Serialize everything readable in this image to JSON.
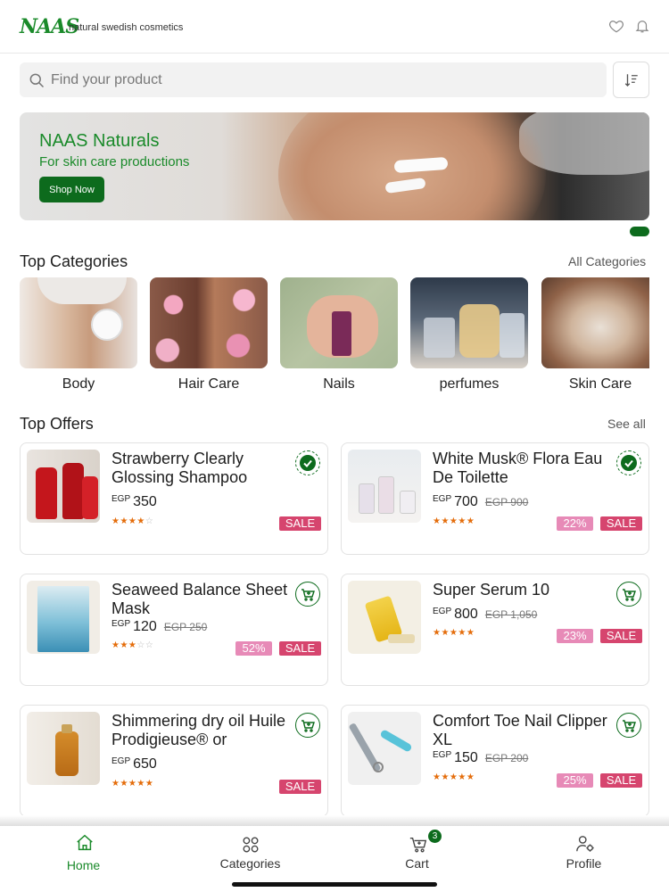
{
  "header": {
    "logo": "NAAS",
    "tagline": "natural swedish cosmetics",
    "icons": [
      "heart-icon",
      "bell-icon"
    ]
  },
  "search": {
    "placeholder": "Find your product",
    "value": ""
  },
  "banner": {
    "title": "NAAS Naturals",
    "subtitle": "For skin care productions",
    "button_label": "Shop Now",
    "active_slide": 1
  },
  "categories_section": {
    "title": "Top Categories",
    "link": "All Categories",
    "items": [
      {
        "label": "Body"
      },
      {
        "label": "Hair Care"
      },
      {
        "label": "Nails"
      },
      {
        "label": "perfumes"
      },
      {
        "label": "Skin Care"
      }
    ]
  },
  "offers_section": {
    "title": "Top Offers",
    "link": "See all",
    "items": [
      {
        "title": "Strawberry Clearly Glossing Shampoo",
        "currency": "EGP",
        "price": "350",
        "old_price": "",
        "rating": 4,
        "discount": "",
        "sale": "SALE",
        "action": "in-cart"
      },
      {
        "title": "White Musk® Flora Eau De Toilette",
        "currency": "EGP",
        "price": "700",
        "old_price": "EGP 900",
        "rating": 5,
        "discount": "22%",
        "sale": "SALE",
        "action": "in-cart"
      },
      {
        "title": "Seaweed Balance Sheet Mask",
        "currency": "EGP",
        "price": "120",
        "old_price": "EGP 250",
        "rating": 3,
        "discount": "52%",
        "sale": "SALE",
        "action": "add-to-cart"
      },
      {
        "title": "Super Serum 10",
        "currency": "EGP",
        "price": "800",
        "old_price": "EGP 1,050",
        "rating": 5,
        "discount": "23%",
        "sale": "SALE",
        "action": "add-to-cart"
      },
      {
        "title": "Shimmering dry oil Huile Prodigieuse® or",
        "currency": "EGP",
        "price": "650",
        "old_price": "",
        "rating": 5,
        "discount": "",
        "sale": "SALE",
        "action": "add-to-cart"
      },
      {
        "title": "Comfort Toe Nail Clipper XL",
        "currency": "EGP",
        "price": "150",
        "old_price": "EGP 200",
        "rating": 5,
        "discount": "25%",
        "sale": "SALE",
        "action": "add-to-cart"
      }
    ]
  },
  "bottom_nav": {
    "items": [
      {
        "label": "Home",
        "icon": "home-icon",
        "active": true
      },
      {
        "label": "Categories",
        "icon": "grid-icon",
        "active": false
      },
      {
        "label": "Cart",
        "icon": "cart-icon",
        "active": false,
        "badge": "3"
      },
      {
        "label": "Profile",
        "icon": "profile-settings-icon",
        "active": false
      }
    ]
  },
  "colors": {
    "brand": "#1a8a2a",
    "brand_dark": "#0d6b1d",
    "sale": "#d6456e",
    "discount": "#e78ab7",
    "star": "#e46c0a"
  }
}
